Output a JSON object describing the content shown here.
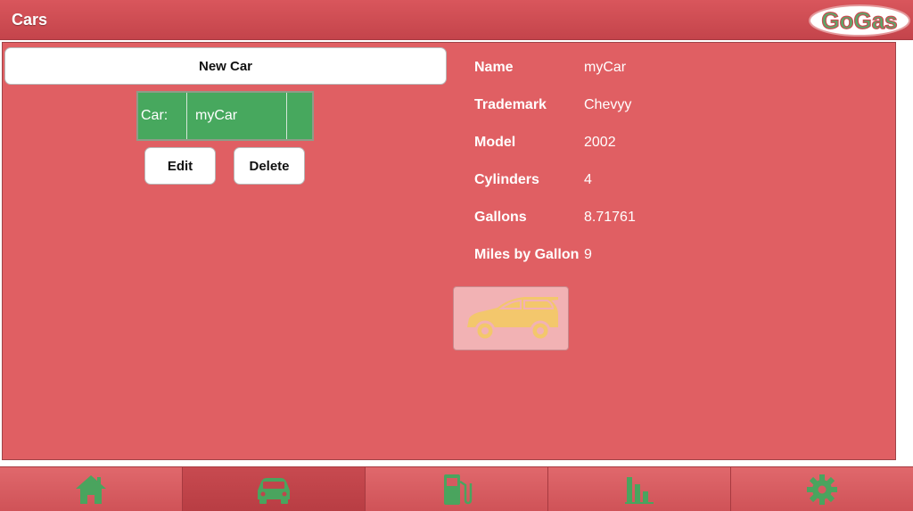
{
  "header": {
    "title": "Cars",
    "logo_text": "GoGas"
  },
  "actions": {
    "new_car_label": "New Car",
    "edit_label": "Edit",
    "delete_label": "Delete"
  },
  "car_selector": {
    "label": "Car:",
    "selected": "myCar"
  },
  "details": [
    {
      "key": "Name",
      "value": "myCar"
    },
    {
      "key": "Trademark",
      "value": "Chevyy"
    },
    {
      "key": "Model",
      "value": "2002"
    },
    {
      "key": "Cylinders",
      "value": "4"
    },
    {
      "key": "Gallons",
      "value": "8.71761"
    },
    {
      "key": "Miles by Gallon",
      "value": "9"
    }
  ],
  "car_image": {
    "icon": "car-icon",
    "color": "#f3c76c"
  },
  "tabs": [
    {
      "icon": "home-icon",
      "active": false
    },
    {
      "icon": "car-icon",
      "active": true
    },
    {
      "icon": "gas-pump-icon",
      "active": false
    },
    {
      "icon": "bar-chart-icon",
      "active": false
    },
    {
      "icon": "gear-icon",
      "active": false
    }
  ],
  "colors": {
    "header": "#d04c53",
    "panel": "#e05f63",
    "selector": "#47a85e",
    "tab_icon": "#4aa45e"
  }
}
